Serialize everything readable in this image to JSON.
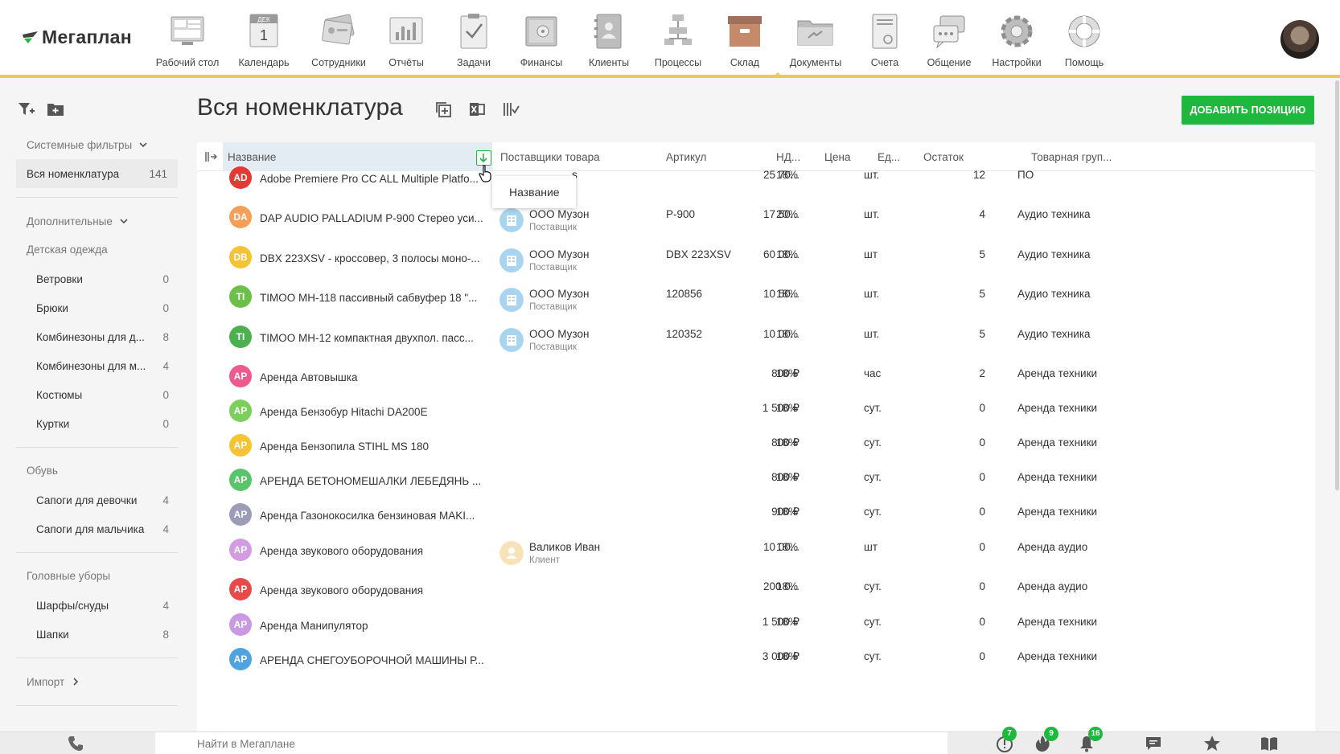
{
  "app": {
    "logo_text": "Мегаплан"
  },
  "nav": [
    {
      "label": "Рабочий стол",
      "icon": "desktop-icon"
    },
    {
      "label": "Календарь",
      "icon": "calendar-icon",
      "calendar_month": "ДЕК",
      "calendar_day": "1"
    },
    {
      "label": "Сотрудники",
      "icon": "employees-icon"
    },
    {
      "label": "Отчёты",
      "icon": "reports-icon"
    },
    {
      "label": "Задачи",
      "icon": "tasks-icon"
    },
    {
      "label": "Финансы",
      "icon": "finance-icon"
    },
    {
      "label": "Клиенты",
      "icon": "clients-icon"
    },
    {
      "label": "Процессы",
      "icon": "processes-icon"
    },
    {
      "label": "Склад",
      "icon": "warehouse-icon",
      "active": true
    },
    {
      "label": "Документы",
      "icon": "documents-icon"
    },
    {
      "label": "Счета",
      "icon": "invoices-icon"
    },
    {
      "label": "Общение",
      "icon": "chat-icon"
    },
    {
      "label": "Настройки",
      "icon": "settings-icon"
    },
    {
      "label": "Помощь",
      "icon": "help-icon"
    }
  ],
  "sidebar": {
    "system_filters_label": "Системные фильтры",
    "selected": {
      "label": "Вся номенклатура",
      "count": "141"
    },
    "extra_label": "Дополнительные",
    "groups": [
      {
        "label": "Детская одежда",
        "items": [
          {
            "label": "Ветровки",
            "count": "0"
          },
          {
            "label": "Брюки",
            "count": "0"
          },
          {
            "label": "Комбинезоны для д...",
            "count": "8"
          },
          {
            "label": "Комбинезоны для м...",
            "count": "4"
          },
          {
            "label": "Костюмы",
            "count": "0"
          },
          {
            "label": "Куртки",
            "count": "0"
          }
        ]
      },
      {
        "label": "Обувь",
        "items": [
          {
            "label": "Сапоги для девочки",
            "count": "4"
          },
          {
            "label": "Сапоги для мальчика",
            "count": "4"
          }
        ]
      },
      {
        "label": "Головные уборы",
        "items": [
          {
            "label": "Шарфы/снуды",
            "count": "4"
          },
          {
            "label": "Шапки",
            "count": "8"
          }
        ]
      }
    ],
    "import_label": "Импорт"
  },
  "header": {
    "title": "Вся номенклатура",
    "add_button": "ДОБАВИТЬ ПОЗИЦИЮ"
  },
  "table": {
    "columns": [
      "Название",
      "Поставщики товара",
      "Артикул",
      "НД...",
      "Цена",
      "Ед...",
      "Остаток",
      "Товарная груп..."
    ],
    "sort_tooltip": "Название",
    "rows": [
      {
        "initials": "AD",
        "color": "#e53935",
        "name": "Adobe Premiere Pro CC ALL Multiple Platfo...",
        "supplier": "",
        "supplier_role": "",
        "supplier_partial": "s",
        "article": "",
        "vat": "18%",
        "price": "25 70...",
        "unit": "шт.",
        "stock": "12",
        "group": "ПО"
      },
      {
        "initials": "DA",
        "color": "#f4a05a",
        "name": "DAP AUDIO PALLADIUM P-900 Стерео уси...",
        "supplier": "ООО Музон",
        "supplier_role": "Поставщик",
        "supplier_type": "company",
        "article": "P-900",
        "vat": "20%",
        "price": "17 50...",
        "unit": "шт.",
        "stock": "4",
        "group": "Аудио техника"
      },
      {
        "initials": "DB",
        "color": "#f5c333",
        "name": "DBX 223XSV - кроссовер, 3 полосы моно-...",
        "supplier": "ООО Музон",
        "supplier_role": "Поставщик",
        "supplier_type": "company",
        "article": "DBX 223XSV",
        "vat": "18%",
        "price": "60 00...",
        "unit": "шт",
        "stock": "5",
        "group": "Аудио техника"
      },
      {
        "initials": "TI",
        "color": "#6cc04a",
        "name": "TIMOO MH-118 пассивный сабвуфер 18 \"...",
        "supplier": "ООО Музон",
        "supplier_role": "Поставщик",
        "supplier_type": "company",
        "article": "120856",
        "vat": "18%",
        "price": "10 50...",
        "unit": "шт.",
        "stock": "5",
        "group": "Аудио техника"
      },
      {
        "initials": "TI",
        "color": "#4caf50",
        "name": "TIMOO MH-12 компактная двухпол. пасс...",
        "supplier": "ООО Музон",
        "supplier_role": "Поставщик",
        "supplier_type": "company",
        "article": "120352",
        "vat": "18%",
        "price": "10 00...",
        "unit": "шт.",
        "stock": "5",
        "group": "Аудио техника"
      },
      {
        "initials": "АР",
        "color": "#ec5a8e",
        "name": "Аренда Автовышка",
        "supplier": "",
        "supplier_role": "",
        "article": "",
        "vat": "18%",
        "price": "800 ₽",
        "unit": "час",
        "stock": "2",
        "group": "Аренда техники"
      },
      {
        "initials": "АР",
        "color": "#7ccf5a",
        "name": "Аренда Бензобур Hitachi DA200E",
        "supplier": "",
        "supplier_role": "",
        "article": "",
        "vat": "18%",
        "price": "1 500 ₽",
        "unit": "сут.",
        "stock": "0",
        "group": "Аренда техники"
      },
      {
        "initials": "АР",
        "color": "#f5c333",
        "name": "Аренда Бензопила STIHL MS 180",
        "supplier": "",
        "supplier_role": "",
        "article": "",
        "vat": "18%",
        "price": "800 ₽",
        "unit": "сут.",
        "stock": "0",
        "group": "Аренда техники"
      },
      {
        "initials": "АР",
        "color": "#5ac46b",
        "name": "АРЕНДА БЕТОНОМЕШАЛКИ ЛЕБЕДЯНЬ ...",
        "supplier": "",
        "supplier_role": "",
        "article": "",
        "vat": "18%",
        "price": "800 ₽",
        "unit": "сут.",
        "stock": "0",
        "group": "Аренда техники"
      },
      {
        "initials": "АР",
        "color": "#9c9cb8",
        "name": "Аренда Газонокосилка бензиновая MAKI...",
        "supplier": "",
        "supplier_role": "",
        "article": "",
        "vat": "18%",
        "price": "900 ₽",
        "unit": "сут.",
        "stock": "0",
        "group": "Аренда техники"
      },
      {
        "initials": "АР",
        "color": "#d39be0",
        "name": "Аренда звукового оборудования",
        "supplier": "Валиков Иван",
        "supplier_role": "Клиент",
        "supplier_type": "person",
        "article": "",
        "vat": "18%",
        "price": "10 00...",
        "unit": "шт",
        "stock": "0",
        "group": "Аренда аудио"
      },
      {
        "initials": "АР",
        "color": "#e84a4a",
        "name": "Аренда звукового оборудования",
        "supplier": "",
        "supplier_role": "",
        "article": "",
        "vat": "18%",
        "price": "200 0...",
        "unit": "сут.",
        "stock": "0",
        "group": "Аренда аудио"
      },
      {
        "initials": "АР",
        "color": "#c99ae2",
        "name": "Аренда Манипулятор",
        "supplier": "",
        "supplier_role": "",
        "article": "",
        "vat": "18%",
        "price": "1 500 ₽",
        "unit": "сут.",
        "stock": "0",
        "group": "Аренда техники"
      },
      {
        "initials": "АР",
        "color": "#4fa3e0",
        "name": "АРЕНДА СНЕГОУБОРОЧНОЙ МАШИНЫ Р...",
        "supplier": "",
        "supplier_role": "",
        "article": "",
        "vat": "18%",
        "price": "3 000 ₽",
        "unit": "сут.",
        "stock": "0",
        "group": "Аренда техники"
      }
    ]
  },
  "bottombar": {
    "search_placeholder": "Найти в Мегаплане",
    "alerts_count": "7",
    "hot_count": "9",
    "notifications_count": "16"
  },
  "colors": {
    "accent_green": "#1fb83f",
    "nav_underline": "#f0c850",
    "name_header_bg": "#e4ecf3"
  }
}
